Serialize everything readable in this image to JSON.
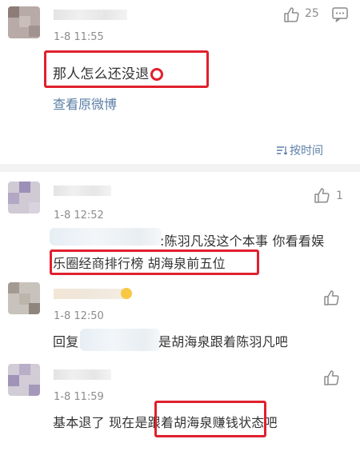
{
  "comments": [
    {
      "time": "1-8 11:55",
      "likes": "25",
      "text": "那人怎么还没退"
    },
    {
      "time": "1-8 12:52",
      "likes": "1",
      "text_line1": ":陈羽凡没这个本事 你看看娱",
      "text_line2": "乐圈经商排行榜 胡海泉前五位"
    },
    {
      "time": "1-8 12:50",
      "likes": "",
      "text_prefix": "回复",
      "text_rest": "是胡海泉跟着陈羽凡吧"
    },
    {
      "time": "1-8 11:59",
      "likes": "",
      "text": "基本退了 现在是跟着胡海泉赚钱状态吧"
    }
  ],
  "view_original_link": "查看原微博",
  "sort_label": "按时间",
  "icons": {
    "like": "thumbs-up-icon",
    "comment": "comment-icon",
    "sort": "sort-icon",
    "circle": "red-circle-emoji",
    "smiley": "smiley-emoji"
  },
  "colors": {
    "highlight": "#e0202d",
    "link": "#5b7fa6",
    "divider": "#f2f2f2"
  }
}
